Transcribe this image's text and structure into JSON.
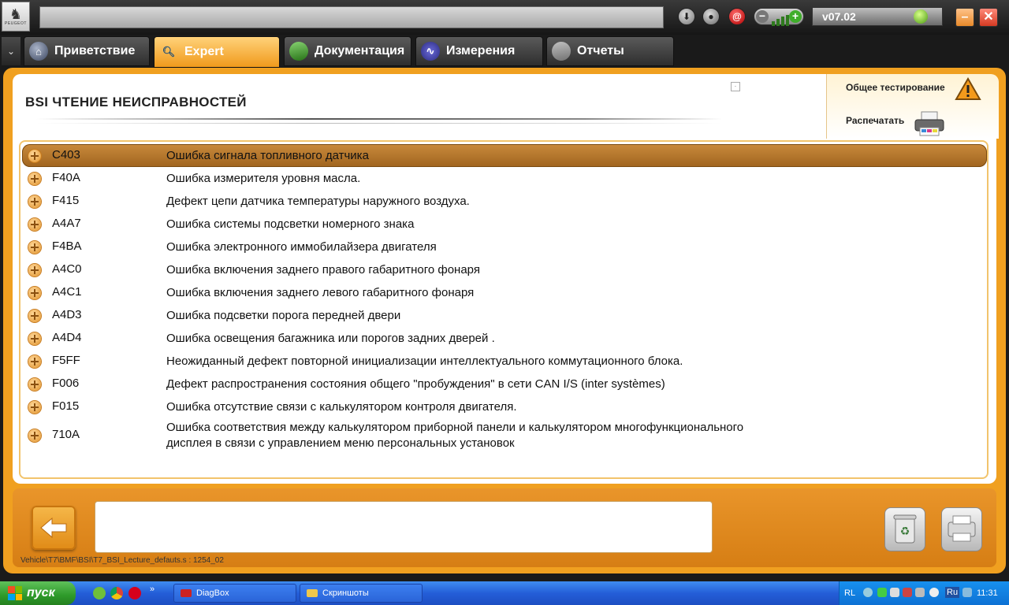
{
  "app": {
    "logo_text": "PEUGEOT",
    "version": "v07.02"
  },
  "tabs": [
    {
      "label": "Приветствие",
      "icon": "home-icon",
      "active": false
    },
    {
      "label": "Expert",
      "icon": "search-icon",
      "active": true
    },
    {
      "label": "Документация",
      "icon": "document-icon",
      "active": false
    },
    {
      "label": "Измерения",
      "icon": "waveform-icon",
      "active": false
    },
    {
      "label": "Отчеты",
      "icon": "report-icon",
      "active": false
    }
  ],
  "page": {
    "title": "BSI  ЧТЕНИЕ НЕИСПРАВНОСТЕЙ",
    "actions": {
      "global_test": "Общее тестирование",
      "print": "Распечатать"
    }
  },
  "faults": [
    {
      "code": "C403",
      "desc": "Ошибка сигнала топливного датчика",
      "selected": true
    },
    {
      "code": "F40A",
      "desc": "Ошибка измерителя уровня масла."
    },
    {
      "code": "F415",
      "desc": "Дефект цепи датчика температуры наружного воздуха."
    },
    {
      "code": "A4A7",
      "desc": "Ошибка системы подсветки номерного знака"
    },
    {
      "code": "F4BA",
      "desc": "Ошибка электронного иммобилайзера двигателя"
    },
    {
      "code": "A4C0",
      "desc": "Ошибка включения заднего правого габаритного фонаря"
    },
    {
      "code": "A4C1",
      "desc": "Ошибка включения заднего левого габаритного фонаря"
    },
    {
      "code": "A4D3",
      "desc": "Ошибка подсветки порога передней двери"
    },
    {
      "code": "A4D4",
      "desc": "Ошибка освещения багажника или порогов задних дверей ."
    },
    {
      "code": "F5FF",
      "desc": "Неожиданный дефект повторной инициализации интеллектуального коммутационного блока."
    },
    {
      "code": "F006",
      "desc": "Дефект распространения состояния общего \"пробуждения\" в сети CAN I/S (inter systèmes)"
    },
    {
      "code": "F015",
      "desc": "Ошибка отсутствие связи с калькулятором контроля двигателя."
    },
    {
      "code": "710A",
      "desc_line1": "Ошибка соответствия между калькулятором приборной панели и калькулятором многофункционального",
      "desc_line2": "дисплея в связи с управлением меню персональных установок"
    }
  ],
  "footer": {
    "message": "",
    "path": "Vehicle\\T7\\BMF\\BSI\\T7_BSI_Lecture_defauts.s : 1254_02"
  },
  "taskbar": {
    "start_label": "пуск",
    "tasks": [
      "DiagBox",
      "Скриншоты"
    ],
    "lang_left": "RL",
    "lang_right": "Ru",
    "clock": "11:31"
  },
  "colors": {
    "accent_orange": "#f0a020",
    "selected_row": "#b07228",
    "tab_dark": "#3a3a3a",
    "taskbar_blue": "#245ed8"
  }
}
